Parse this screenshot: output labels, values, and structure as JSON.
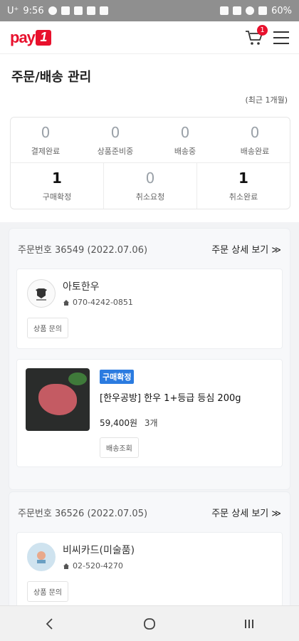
{
  "status_bar": {
    "carrier": "U⁺",
    "time": "9:56",
    "battery": "60%"
  },
  "header": {
    "logo_text": "pay",
    "logo_box": "1",
    "cart_count": "1"
  },
  "page": {
    "title": "주문/배송 관리",
    "period": "(최근 1개월)"
  },
  "summary": {
    "row1": [
      {
        "count": "0",
        "label": "결제완료"
      },
      {
        "count": "0",
        "label": "상품준비중"
      },
      {
        "count": "0",
        "label": "배송중"
      },
      {
        "count": "0",
        "label": "배송완료"
      }
    ],
    "row2": [
      {
        "count": "1",
        "label": "구매확정"
      },
      {
        "count": "0",
        "label": "취소요청"
      },
      {
        "count": "1",
        "label": "취소완료"
      }
    ]
  },
  "orders": [
    {
      "number": "주문번호 36549 (2022.07.06)",
      "detail_link": "주문 상세 보기 ≫",
      "seller": {
        "name": "아토한우",
        "phone": "070-4242-0851",
        "inquiry_button": "상품 문의"
      },
      "product": {
        "status_tag": "구매확정",
        "name": "[한우공방] 한우 1+등급 등심 200g",
        "price": "59,400원",
        "quantity": "3개",
        "track_button": "배송조회"
      }
    },
    {
      "number": "주문번호 36526 (2022.07.05)",
      "detail_link": "주문 상세 보기 ≫",
      "seller": {
        "name": "비씨카드(미술품)",
        "phone": "02-520-4270",
        "inquiry_button": "상품 문의"
      }
    }
  ],
  "colors": {
    "brand": "#e8112d",
    "tag_blue": "#2b7be0"
  }
}
